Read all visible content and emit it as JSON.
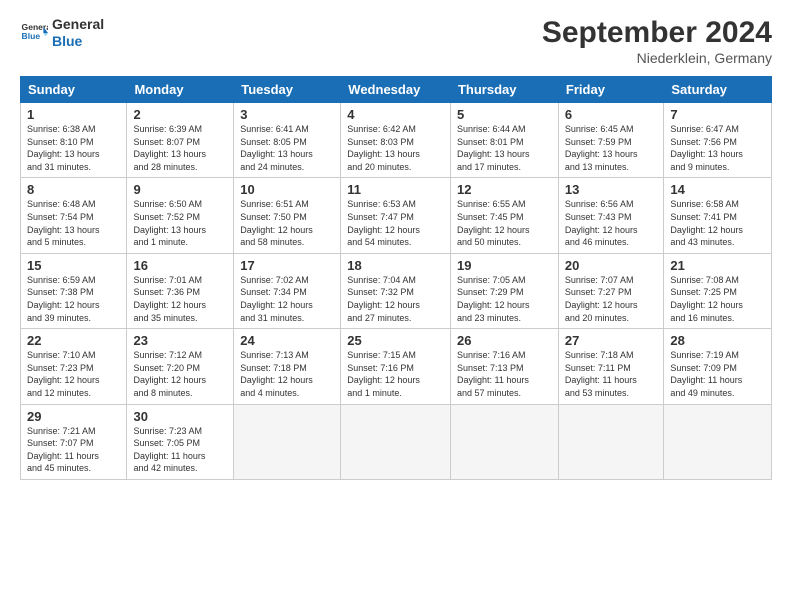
{
  "logo": {
    "line1": "General",
    "line2": "Blue"
  },
  "title": "September 2024",
  "location": "Niederklein, Germany",
  "days_of_week": [
    "Sunday",
    "Monday",
    "Tuesday",
    "Wednesday",
    "Thursday",
    "Friday",
    "Saturday"
  ],
  "weeks": [
    [
      {
        "day": "1",
        "info": "Sunrise: 6:38 AM\nSunset: 8:10 PM\nDaylight: 13 hours\nand 31 minutes."
      },
      {
        "day": "2",
        "info": "Sunrise: 6:39 AM\nSunset: 8:07 PM\nDaylight: 13 hours\nand 28 minutes."
      },
      {
        "day": "3",
        "info": "Sunrise: 6:41 AM\nSunset: 8:05 PM\nDaylight: 13 hours\nand 24 minutes."
      },
      {
        "day": "4",
        "info": "Sunrise: 6:42 AM\nSunset: 8:03 PM\nDaylight: 13 hours\nand 20 minutes."
      },
      {
        "day": "5",
        "info": "Sunrise: 6:44 AM\nSunset: 8:01 PM\nDaylight: 13 hours\nand 17 minutes."
      },
      {
        "day": "6",
        "info": "Sunrise: 6:45 AM\nSunset: 7:59 PM\nDaylight: 13 hours\nand 13 minutes."
      },
      {
        "day": "7",
        "info": "Sunrise: 6:47 AM\nSunset: 7:56 PM\nDaylight: 13 hours\nand 9 minutes."
      }
    ],
    [
      {
        "day": "8",
        "info": "Sunrise: 6:48 AM\nSunset: 7:54 PM\nDaylight: 13 hours\nand 5 minutes."
      },
      {
        "day": "9",
        "info": "Sunrise: 6:50 AM\nSunset: 7:52 PM\nDaylight: 13 hours\nand 1 minute."
      },
      {
        "day": "10",
        "info": "Sunrise: 6:51 AM\nSunset: 7:50 PM\nDaylight: 12 hours\nand 58 minutes."
      },
      {
        "day": "11",
        "info": "Sunrise: 6:53 AM\nSunset: 7:47 PM\nDaylight: 12 hours\nand 54 minutes."
      },
      {
        "day": "12",
        "info": "Sunrise: 6:55 AM\nSunset: 7:45 PM\nDaylight: 12 hours\nand 50 minutes."
      },
      {
        "day": "13",
        "info": "Sunrise: 6:56 AM\nSunset: 7:43 PM\nDaylight: 12 hours\nand 46 minutes."
      },
      {
        "day": "14",
        "info": "Sunrise: 6:58 AM\nSunset: 7:41 PM\nDaylight: 12 hours\nand 43 minutes."
      }
    ],
    [
      {
        "day": "15",
        "info": "Sunrise: 6:59 AM\nSunset: 7:38 PM\nDaylight: 12 hours\nand 39 minutes."
      },
      {
        "day": "16",
        "info": "Sunrise: 7:01 AM\nSunset: 7:36 PM\nDaylight: 12 hours\nand 35 minutes."
      },
      {
        "day": "17",
        "info": "Sunrise: 7:02 AM\nSunset: 7:34 PM\nDaylight: 12 hours\nand 31 minutes."
      },
      {
        "day": "18",
        "info": "Sunrise: 7:04 AM\nSunset: 7:32 PM\nDaylight: 12 hours\nand 27 minutes."
      },
      {
        "day": "19",
        "info": "Sunrise: 7:05 AM\nSunset: 7:29 PM\nDaylight: 12 hours\nand 23 minutes."
      },
      {
        "day": "20",
        "info": "Sunrise: 7:07 AM\nSunset: 7:27 PM\nDaylight: 12 hours\nand 20 minutes."
      },
      {
        "day": "21",
        "info": "Sunrise: 7:08 AM\nSunset: 7:25 PM\nDaylight: 12 hours\nand 16 minutes."
      }
    ],
    [
      {
        "day": "22",
        "info": "Sunrise: 7:10 AM\nSunset: 7:23 PM\nDaylight: 12 hours\nand 12 minutes."
      },
      {
        "day": "23",
        "info": "Sunrise: 7:12 AM\nSunset: 7:20 PM\nDaylight: 12 hours\nand 8 minutes."
      },
      {
        "day": "24",
        "info": "Sunrise: 7:13 AM\nSunset: 7:18 PM\nDaylight: 12 hours\nand 4 minutes."
      },
      {
        "day": "25",
        "info": "Sunrise: 7:15 AM\nSunset: 7:16 PM\nDaylight: 12 hours\nand 1 minute."
      },
      {
        "day": "26",
        "info": "Sunrise: 7:16 AM\nSunset: 7:13 PM\nDaylight: 11 hours\nand 57 minutes."
      },
      {
        "day": "27",
        "info": "Sunrise: 7:18 AM\nSunset: 7:11 PM\nDaylight: 11 hours\nand 53 minutes."
      },
      {
        "day": "28",
        "info": "Sunrise: 7:19 AM\nSunset: 7:09 PM\nDaylight: 11 hours\nand 49 minutes."
      }
    ],
    [
      {
        "day": "29",
        "info": "Sunrise: 7:21 AM\nSunset: 7:07 PM\nDaylight: 11 hours\nand 45 minutes."
      },
      {
        "day": "30",
        "info": "Sunrise: 7:23 AM\nSunset: 7:05 PM\nDaylight: 11 hours\nand 42 minutes."
      },
      null,
      null,
      null,
      null,
      null
    ]
  ]
}
